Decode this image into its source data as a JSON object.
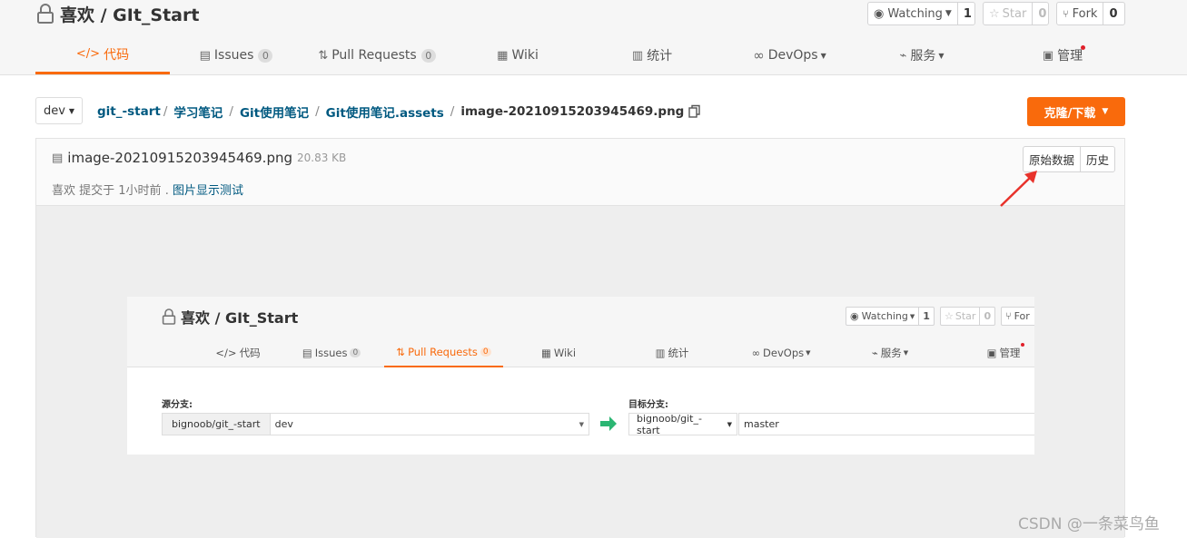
{
  "header": {
    "repo_title": "喜欢 / GIt_Start",
    "watching": {
      "label": "Watching",
      "count": "1"
    },
    "star": {
      "label": "Star",
      "count": "0"
    },
    "fork": {
      "label": "Fork",
      "count": "0"
    }
  },
  "tabs": [
    {
      "label": "代码",
      "icon": "code-icon",
      "active": true
    },
    {
      "label": "Issues",
      "badge": "0",
      "icon": "issues-icon"
    },
    {
      "label": "Pull Requests",
      "badge": "0",
      "icon": "pull-request-icon"
    },
    {
      "label": "Wiki",
      "icon": "wiki-icon"
    },
    {
      "label": "统计",
      "icon": "stats-icon"
    },
    {
      "label": "DevOps",
      "icon": "devops-icon"
    },
    {
      "label": "服务",
      "icon": "service-icon"
    },
    {
      "label": "管理",
      "icon": "manage-icon"
    }
  ],
  "branch": {
    "value": "dev"
  },
  "breadcrumb": {
    "root": "git_-start",
    "p1": "学习笔记",
    "p2": "Git使用笔记",
    "p3": "Git使用笔记.assets",
    "current": "image-20210915203945469.png"
  },
  "clone_button": "克隆/下载",
  "file": {
    "name": "image-20210915203945469.png",
    "size": "20.83 KB",
    "commit_author": "喜欢",
    "commit_text": "提交于 1小时前 .",
    "commit_message": "图片显示测试",
    "raw_label": "原始数据",
    "history_label": "历史"
  },
  "embedded": {
    "repo_title": "喜欢 / GIt_Start",
    "watching": {
      "label": "Watching",
      "count": "1"
    },
    "star": {
      "label": "Star",
      "count": "0"
    },
    "fork": {
      "label": "For"
    },
    "tabs": {
      "code": "代码",
      "issues": "Issues",
      "issues_badge": "0",
      "pr": "Pull Requests",
      "pr_badge": "0",
      "wiki": "Wiki",
      "stats": "统计",
      "devops": "DevOps",
      "service": "服务",
      "manage": "管理"
    },
    "source_label": "源分支:",
    "source_repo": "bignoob/git_-start",
    "source_branch": "dev",
    "target_label": "目标分支:",
    "target_repo": "bignoob/git_-start",
    "target_branch": "master"
  },
  "watermark": "CSDN @一条菜鸟鱼",
  "colors": {
    "accent": "#f96a0c",
    "link": "#005980",
    "annotation_arrow": "#e8322b"
  }
}
